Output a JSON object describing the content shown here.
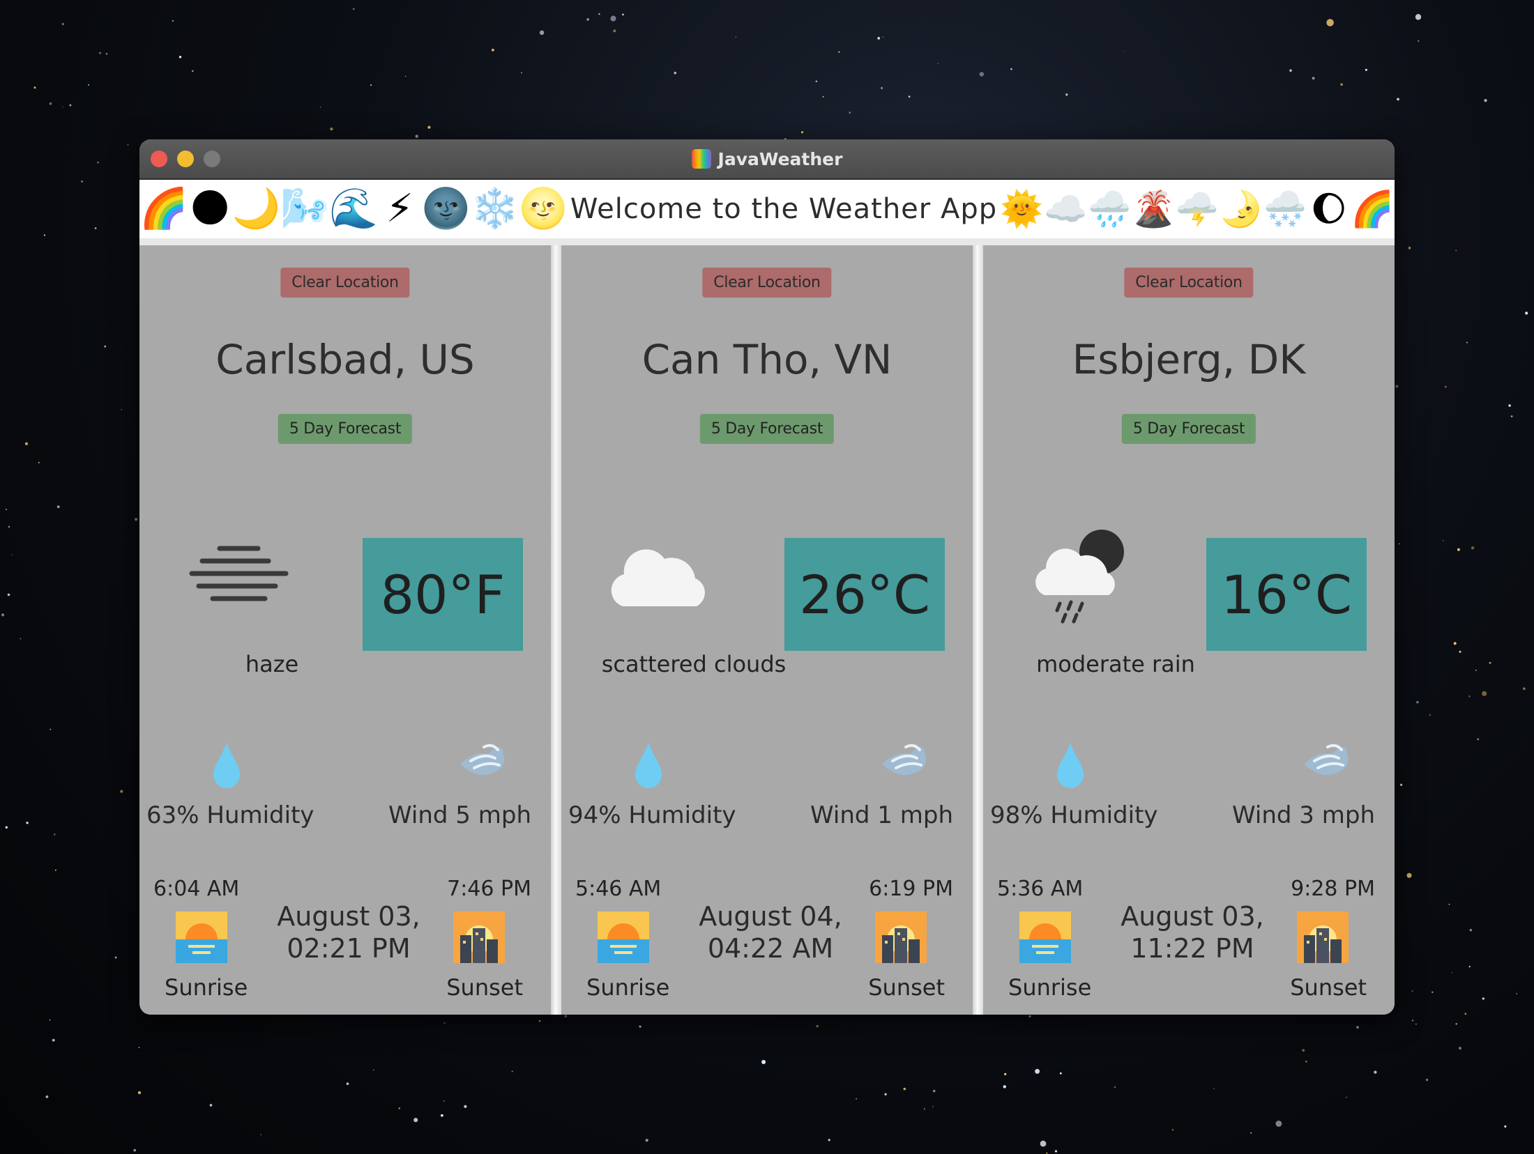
{
  "window": {
    "title": "JavaWeather"
  },
  "banner": {
    "welcome": "Welcome to the Weather App",
    "left_icons": [
      "🌈",
      "🌑",
      "🌙",
      "🌬️",
      "🌊",
      "⚡",
      "🌚",
      "❄️",
      "🌝"
    ],
    "right_icons": [
      "🌞",
      "☁️",
      "🌧️",
      "🌋",
      "🌩️",
      "🌛",
      "🌨️",
      "🌔",
      "🌈"
    ]
  },
  "panels": [
    {
      "clear_label": "Clear Location",
      "city": "Carlsbad, US",
      "forecast_label": "5 Day Forecast",
      "condition": "haze",
      "condition_icon": "haze-icon",
      "temperature": "80°F",
      "humidity": "63% Humidity",
      "wind": "Wind 5 mph",
      "sunrise_time": "6:04 AM",
      "sunset_time": "7:46 PM",
      "date_line1": "August 03,",
      "date_line2": "02:21 PM",
      "sunrise_label": "Sunrise",
      "sunset_label": "Sunset"
    },
    {
      "clear_label": "Clear Location",
      "city": "Can Tho, VN",
      "forecast_label": "5 Day Forecast",
      "condition": "scattered clouds",
      "condition_icon": "cloud-icon",
      "temperature": "26°C",
      "humidity": "94% Humidity",
      "wind": "Wind 1 mph",
      "sunrise_time": "5:46 AM",
      "sunset_time": "6:19 PM",
      "date_line1": "August 04,",
      "date_line2": "04:22 AM",
      "sunrise_label": "Sunrise",
      "sunset_label": "Sunset"
    },
    {
      "clear_label": "Clear Location",
      "city": "Esbjerg, DK",
      "forecast_label": "5 Day Forecast",
      "condition": "moderate rain",
      "condition_icon": "night-rain-icon",
      "temperature": "16°C",
      "humidity": "98% Humidity",
      "wind": "Wind 3 mph",
      "sunrise_time": "5:36 AM",
      "sunset_time": "9:28 PM",
      "date_line1": "August 03,",
      "date_line2": "11:22 PM",
      "sunrise_label": "Sunrise",
      "sunset_label": "Sunset"
    }
  ],
  "colors": {
    "clear_button": "#ad6b6b",
    "forecast_button": "#6d9a6d",
    "temp_box": "#469b9b",
    "panel_bg": "#a9a9a9"
  }
}
